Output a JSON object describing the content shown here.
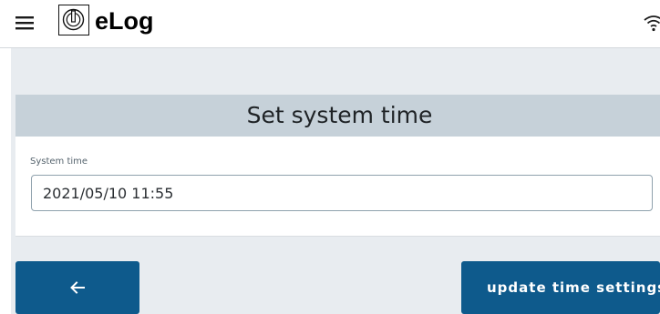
{
  "header": {
    "app_name": "eLog",
    "icons": {
      "menu": "hamburger-menu-icon",
      "logo": "power-symbol-logo-icon",
      "status": "wifi-icon"
    }
  },
  "card": {
    "title": "Set system time",
    "field_label": "System time",
    "field_value": "2021/05/10 11:55"
  },
  "actions": {
    "back_icon": "arrow-left-icon",
    "update_label": "update time settings"
  },
  "colors": {
    "primary": "#0e5a8c",
    "card_header": "#c6d1d9",
    "background": "#e8ecf0"
  }
}
